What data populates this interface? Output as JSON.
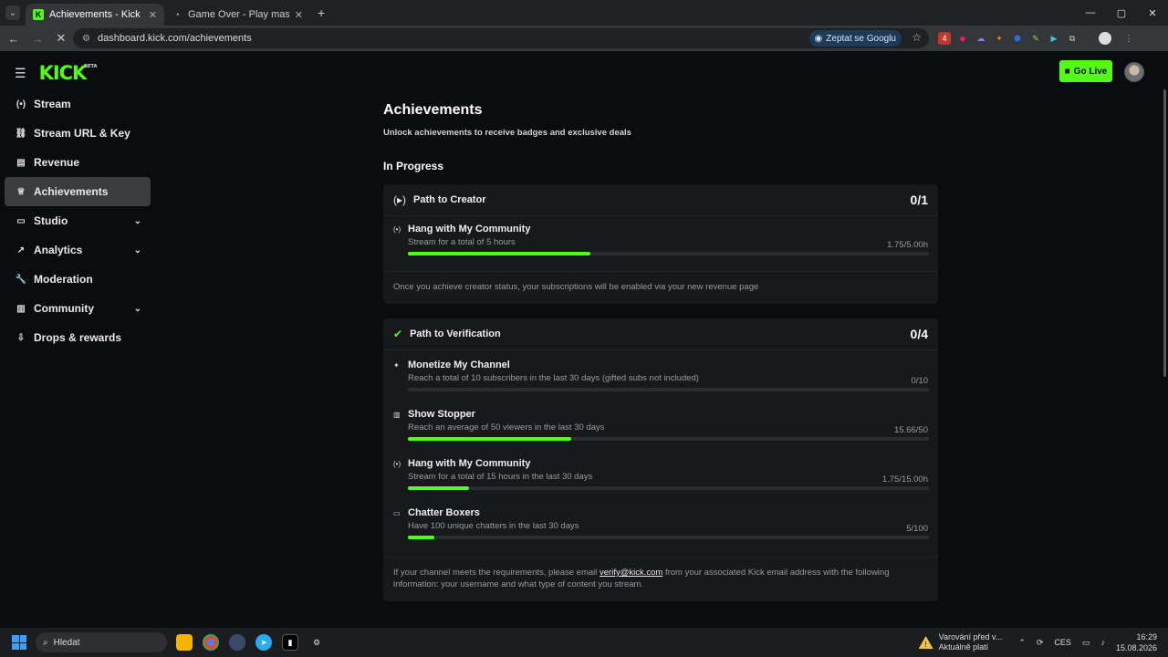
{
  "browser": {
    "tabs": [
      {
        "title": "Achievements - Kick Dashboard",
        "active": true,
        "favicon": "K"
      },
      {
        "title": "Game Over - Play master_chess",
        "active": false,
        "favicon": "◔"
      }
    ],
    "url": "dashboard.kick.com/achievements",
    "google_button": "Zeptat se Googlu",
    "window_controls": [
      "—",
      "▢",
      "✕"
    ]
  },
  "app": {
    "logo": "KICK",
    "logo_badge": "BETA",
    "go_live_label": "Go Live",
    "sidebar": {
      "items": [
        {
          "label": "Stream",
          "icon": "(•)",
          "icon_name": "broadcast-icon",
          "chevron": false,
          "active": false
        },
        {
          "label": "Stream URL & Key",
          "icon": "⛓",
          "icon_name": "link-icon",
          "chevron": false,
          "active": false
        },
        {
          "label": "Revenue",
          "icon": "▤",
          "icon_name": "revenue-icon",
          "chevron": false,
          "active": false
        },
        {
          "label": "Achievements",
          "icon": "♕",
          "icon_name": "trophy-icon",
          "chevron": false,
          "active": true
        },
        {
          "label": "Studio",
          "icon": "▭",
          "icon_name": "studio-icon",
          "chevron": true,
          "active": false
        },
        {
          "label": "Analytics",
          "icon": "↗",
          "icon_name": "analytics-icon",
          "chevron": true,
          "active": false
        },
        {
          "label": "Moderation",
          "icon": "🔧",
          "icon_name": "wrench-icon",
          "chevron": false,
          "active": false
        },
        {
          "label": "Community",
          "icon": "▥",
          "icon_name": "community-icon",
          "chevron": true,
          "active": false
        },
        {
          "label": "Drops & rewards",
          "icon": "⇩",
          "icon_name": "drops-icon",
          "chevron": false,
          "active": false
        }
      ]
    },
    "page": {
      "title": "Achievements",
      "subtitle": "Unlock achievements to receive badges and exclusive deals",
      "section_title": "In Progress",
      "creator_card": {
        "title": "Path to Creator",
        "count": "0/1",
        "tasks": [
          {
            "name": "Hang with My Community",
            "desc": "Stream for a total of 5 hours",
            "value": "1.75/5.00h",
            "progress": 0.35
          }
        ],
        "footer": "Once you achieve creator status, your subscriptions will be enabled via your new revenue page"
      },
      "verification_card": {
        "title": "Path to Verification",
        "count": "0/4",
        "tasks": [
          {
            "name": "Monetize My Channel",
            "desc": "Reach a total of 10 subscribers in the last 30 days (gifted subs not included)",
            "value": "0/10",
            "progress": 0.0
          },
          {
            "name": "Show Stopper",
            "desc": "Reach an average of 50 viewers in the last 30 days",
            "value": "15.66/50",
            "progress": 0.3132
          },
          {
            "name": "Hang with My Community",
            "desc": "Stream for a total of 15 hours in the last 30 days",
            "value": "1.75/15.00h",
            "progress": 0.1167
          },
          {
            "name": "Chatter Boxers",
            "desc": "Have 100 unique chatters in the last 30 days",
            "value": "5/100",
            "progress": 0.05
          }
        ],
        "footer_before": "If your channel meets the requirements, please email ",
        "footer_email": "verify@kick.com",
        "footer_after": " from your associated Kick email address with the following information: your username and what type of content you stream."
      }
    }
  },
  "taskbar": {
    "search_placeholder": "Hledat",
    "warning_line1": "Varování před v...",
    "warning_line2": "Aktuálně platí",
    "language": "CES",
    "time": "16:29",
    "date": "15.08.2026"
  },
  "colors": {
    "accent": "#53fc18",
    "bg": "#0b0c0d",
    "card": "#18191b"
  }
}
